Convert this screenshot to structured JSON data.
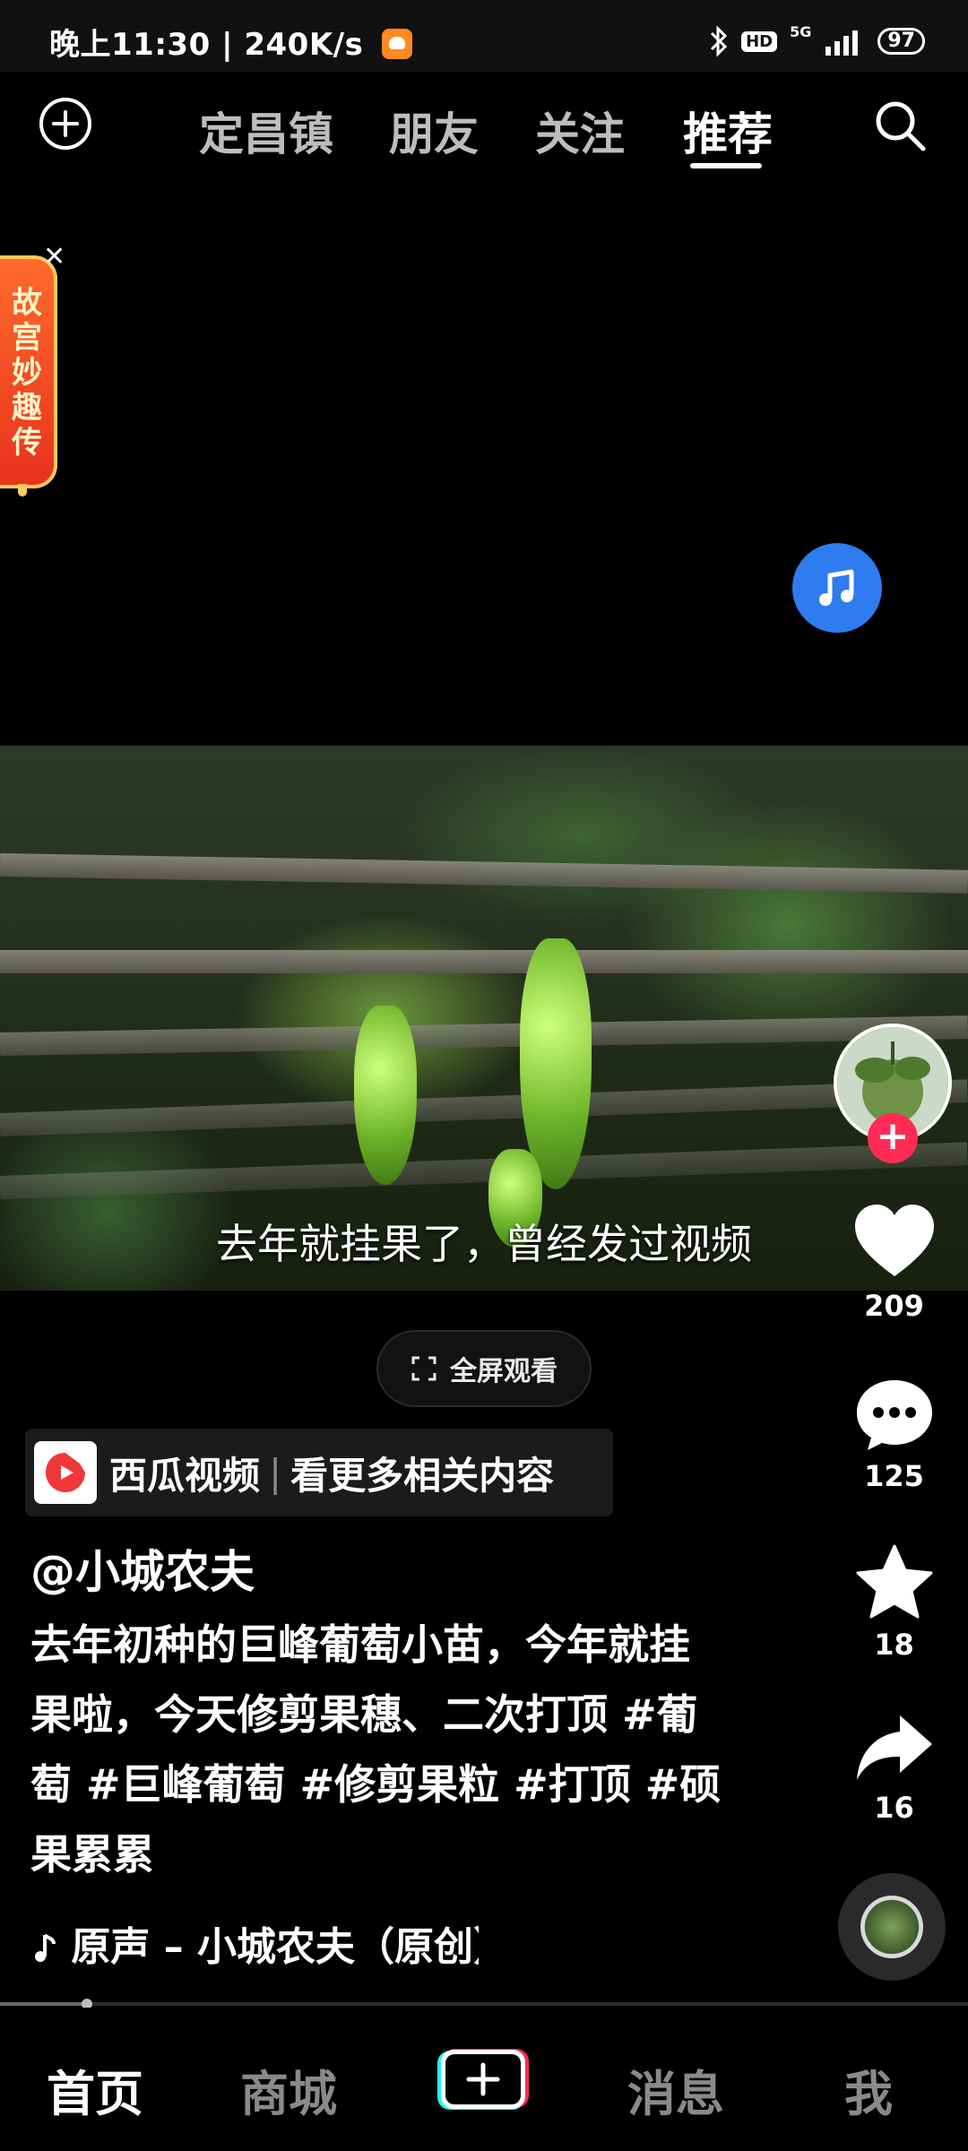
{
  "status_bar": {
    "time": "晚上11:30",
    "separator": "|",
    "speed": "240K/s",
    "hd": "HD",
    "net": "5G",
    "battery": "97"
  },
  "top_nav": {
    "tabs": [
      {
        "label": "定昌镇"
      },
      {
        "label": "朋友"
      },
      {
        "label": "关注"
      },
      {
        "label": "推荐"
      }
    ],
    "active_tab": "推荐"
  },
  "ad_banner": {
    "text": "故宫妙趣传",
    "close": "✕"
  },
  "video": {
    "caption": "去年就挂果了，曾经发过视频"
  },
  "fullscreen": {
    "label": "全屏观看"
  },
  "xigua": {
    "brand": "西瓜视频",
    "separator": "|",
    "cta": "看更多相关内容"
  },
  "post": {
    "author": "@小城农夫",
    "description": "去年初种的巨峰葡萄小苗，今年就挂果啦，今天修剪果穗、二次打顶 #葡萄 #巨峰葡萄 #修剪果粒 #打顶 #硕果累累",
    "sound": "原声 – 小城农夫（原创）"
  },
  "actions": {
    "likes": "209",
    "comments": "125",
    "favorites": "18",
    "shares": "16"
  },
  "playback": {
    "progress_fraction": 0.09
  },
  "bottom_nav": {
    "items": [
      {
        "label": "首页"
      },
      {
        "label": "商城"
      },
      {
        "label": "消息"
      },
      {
        "label": "我"
      }
    ],
    "active": "首页"
  },
  "colors": {
    "accent_pink": "#fe2c55",
    "accent_cyan": "#25f4ee",
    "music_blue": "#2f7bf0"
  },
  "icons": [
    "plus-circle-icon",
    "search-icon",
    "music-note-icon",
    "heart-icon",
    "comment-icon",
    "star-icon",
    "share-icon",
    "fullscreen-icon",
    "xigua-logo-icon",
    "music-disc-icon",
    "create-plus-icon"
  ]
}
